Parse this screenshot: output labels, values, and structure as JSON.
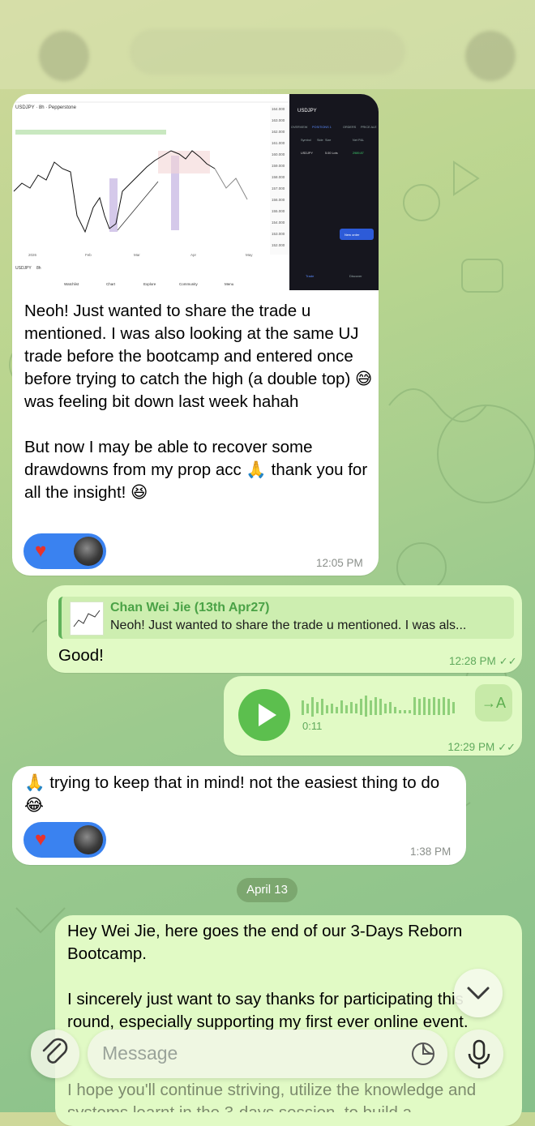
{
  "messages": {
    "m1": {
      "text": "Neoh! Just wanted to share the trade u mentioned. I was also looking at the same UJ trade before the bootcamp and entered once before trying to catch the high (a double top) 😅 was feeling bit down last week hahah\n\nBut now I may be able to recover some drawdowns from my prop acc 🙏 thank you for all the insight! 😆",
      "time": "12:05 PM",
      "screenshot": {
        "left_symbol": "USDJPY · 8h · Pepperstone",
        "left_symbol_short": "USDJPY",
        "left_tf": "8h",
        "left_months": [
          "2026",
          "Feb",
          "Mar",
          "Apr",
          "May"
        ],
        "left_price_ticks": [
          "164.000",
          "163.000",
          "162.000",
          "161.000",
          "160.000",
          "159.000",
          "158.000",
          "157.000",
          "156.000",
          "155.000",
          "154.000",
          "153.000",
          "152.000",
          "151.000"
        ],
        "left_bottom_tabs": [
          "Watchlist",
          "Chart",
          "Explore",
          "Community",
          "Menu"
        ],
        "right_symbol": "USDJPY",
        "right_tabs": [
          "OVERVIEW",
          "POSITIONS 1",
          "ORDERS",
          "PRICE ALE"
        ],
        "right_cols": [
          "Symbol",
          "Side",
          "Size",
          "Net P&L"
        ],
        "right_row": {
          "symbol": "USDJPY",
          "size": "5.00 Lots",
          "pnl": "2989.87"
        },
        "right_new_order": "New order",
        "right_bottom_tabs": [
          "Trade",
          "Discover"
        ]
      }
    },
    "m2": {
      "reply_name": "Chan Wei Jie (13th Apr27)",
      "reply_text": "Neoh! Just wanted to share the trade u mentioned. I was als...",
      "text": "Good!",
      "time": "12:28 PM"
    },
    "m3": {
      "duration": "0:11",
      "transcribe_label": "→A",
      "time": "12:29 PM"
    },
    "m4": {
      "text": "🙏 trying to keep that in mind! not the easiest thing to do 😂",
      "time": "1:38 PM"
    },
    "date_separator": "April 13",
    "m5": {
      "text": "Hey Wei Jie, here goes the end of our 3-Days Reborn Bootcamp.\n\nI sincerely just want to say thanks for participating this round, especially supporting my first ever online event.",
      "partial_bottom": "I hope you'll continue striving, utilize the knowledge and systems learnt in the 3-days session, to build a"
    }
  },
  "composer": {
    "placeholder": "Message"
  },
  "icons": {
    "attach": "paperclip-icon",
    "sticker": "sticker-icon",
    "mic": "microphone-icon",
    "scroll": "chevron-down-icon",
    "heart": "heart-icon",
    "play": "play-icon",
    "ticks": "double-check-icon"
  },
  "colors": {
    "incoming_bubble": "#ffffff",
    "outgoing_bubble": "#e1fac5",
    "accent_green": "#5cbf4e",
    "reaction_blue": "#3a82f0"
  }
}
